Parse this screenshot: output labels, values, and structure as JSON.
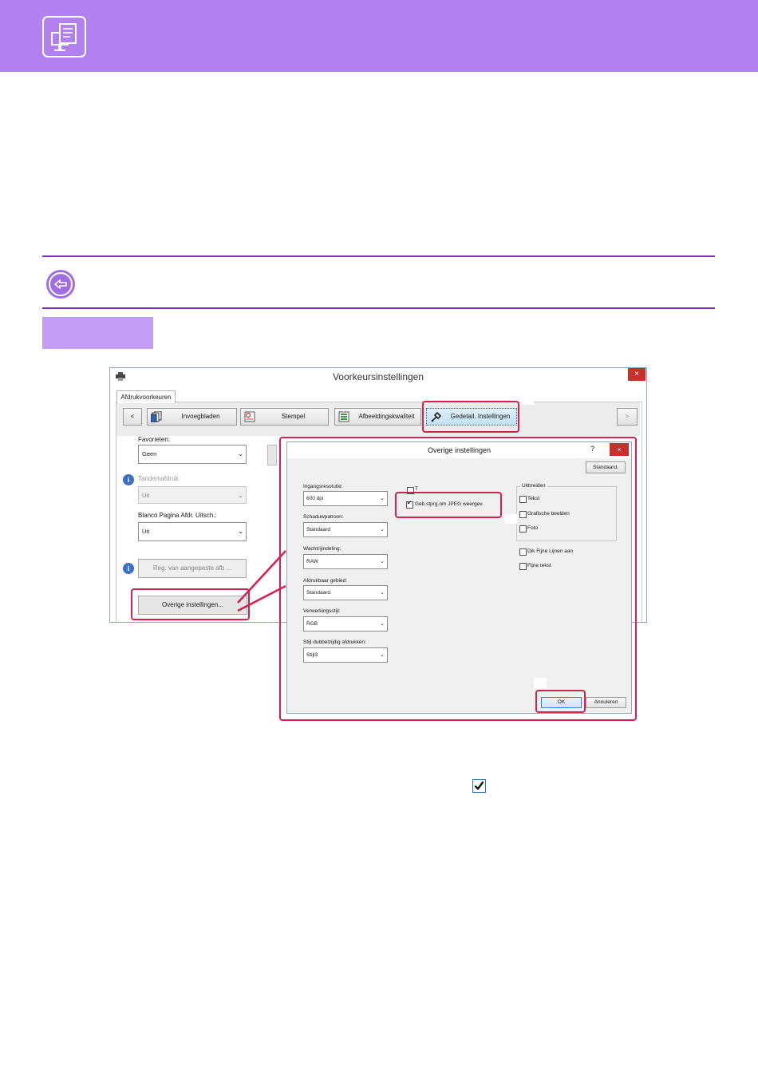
{
  "main_dialog": {
    "title": "Voorkeursinstellingen",
    "close": "×",
    "tab": "Afdrukvoorkeuren",
    "toolbar": {
      "prev": "<",
      "next": ">",
      "buttons": [
        "Invoegbladen",
        "Stempel",
        "Afbeeldingskwaliteit",
        "Gedetail. Instellingen"
      ]
    },
    "favorites_label": "Favorieten:",
    "favorites_value": "Geen",
    "tandem_label": "Tandemafdruk:",
    "tandem_value": "Uit",
    "blank_label": "Blanco Pagina Afdr. Uitsch.:",
    "blank_value": "Uit",
    "reg_button": "Reg. van aangepaste afb ...",
    "other_button": "Overige instellingen..."
  },
  "sub_dialog": {
    "title": "Overige instellingen",
    "help": "?",
    "close": "×",
    "standard_button": "Standaard.",
    "fields": [
      {
        "label": "Ingangsresolutie:",
        "value": "600 dpi"
      },
      {
        "label": "Schaduwpatroon:",
        "value": "Standaard"
      },
      {
        "label": "Wachtrijindeling:",
        "value": "RAW"
      },
      {
        "label": "Afdrukbaar gebied:",
        "value": "Standaard"
      },
      {
        "label": "Verwerkingsstijl:",
        "value": "RGB"
      },
      {
        "label": "Stijl dubbelzijdig afdrukken:",
        "value": "Stijl3"
      }
    ],
    "partial_check_label": "T",
    "jpeg_check_label": "Geb.stprg.om JPEG weergev.",
    "expand_group": {
      "title": "Uitbreiden",
      "items": [
        "Tekst",
        "Grafische beelden",
        "Foto"
      ]
    },
    "thin_lines": "Dik Fijne Lijnen aan",
    "thin_text": "Fijne tekst",
    "ok": "OK",
    "cancel": "Annuleren"
  },
  "icons": {
    "header": "printer-monitor-icon",
    "note": "back-arrow-icon",
    "checkbox": "checkmark-icon"
  },
  "colors": {
    "header": "#b182ef",
    "rule": "#7b2ec4",
    "highlight": "#d6204e"
  }
}
